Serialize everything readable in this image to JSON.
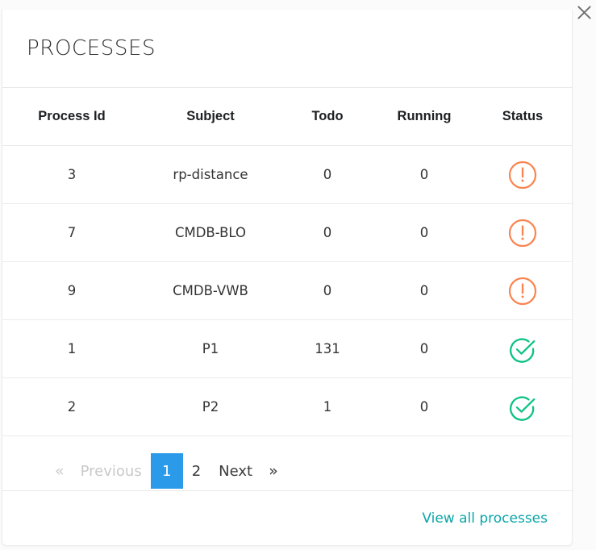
{
  "window": {
    "close_icon": "close-icon"
  },
  "card": {
    "title": "PROCESSES"
  },
  "table": {
    "columns": [
      {
        "key": "process_id",
        "label": "Process Id"
      },
      {
        "key": "subject",
        "label": "Subject"
      },
      {
        "key": "todo",
        "label": "Todo"
      },
      {
        "key": "running",
        "label": "Running"
      },
      {
        "key": "status",
        "label": "Status"
      }
    ],
    "rows": [
      {
        "process_id": "3",
        "subject": "rp-distance",
        "todo": "0",
        "running": "0",
        "status": "warning",
        "status_icon": "exclamation-circle-icon"
      },
      {
        "process_id": "7",
        "subject": "CMDB-BLO",
        "todo": "0",
        "running": "0",
        "status": "warning",
        "status_icon": "exclamation-circle-icon"
      },
      {
        "process_id": "9",
        "subject": "CMDB-VWB",
        "todo": "0",
        "running": "0",
        "status": "warning",
        "status_icon": "exclamation-circle-icon"
      },
      {
        "process_id": "1",
        "subject": "P1",
        "todo": "131",
        "running": "0",
        "status": "ok",
        "status_icon": "check-circle-icon"
      },
      {
        "process_id": "2",
        "subject": "P2",
        "todo": "1",
        "running": "0",
        "status": "ok",
        "status_icon": "check-circle-icon"
      }
    ]
  },
  "pagination": {
    "first_label": "«",
    "previous_label": "Previous",
    "pages": [
      "1",
      "2"
    ],
    "active_page": "1",
    "next_label": "Next",
    "last_label": "»"
  },
  "footer": {
    "view_all_label": "View all processes"
  },
  "colors": {
    "accent_blue": "#2b9ae8",
    "link_teal": "#0aa5a8",
    "status_warning": "#fb8350",
    "status_ok": "#0ec286",
    "text_dark": "#2f2f2f",
    "muted": "#c9c9c9"
  }
}
